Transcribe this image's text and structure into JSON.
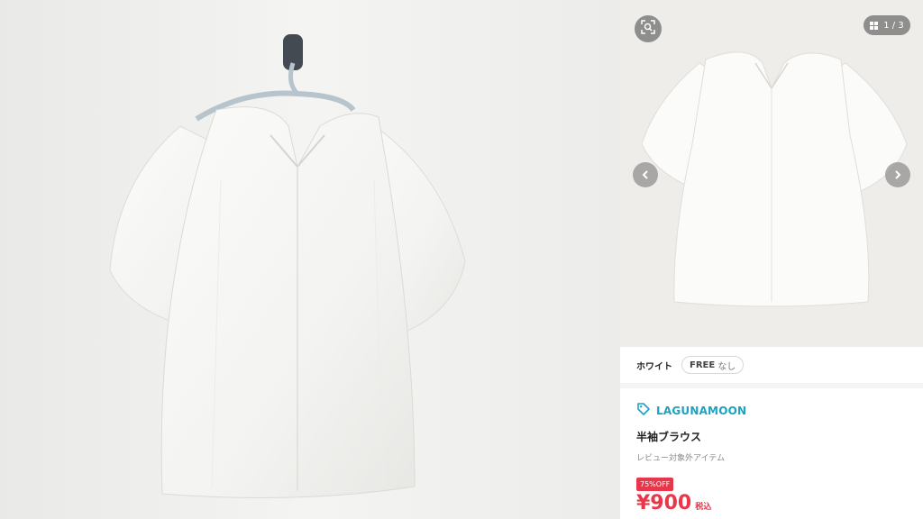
{
  "left_photo": {
    "description_icon": "hanging-blouse-photo"
  },
  "gallery": {
    "counter": "1 / 3",
    "icons": {
      "lens": "image-search-icon",
      "grid": "grid-icon",
      "prev": "chevron-left-icon",
      "next": "chevron-right-icon"
    }
  },
  "options": {
    "color": "ホワイト",
    "size": "FREE",
    "stock": "なし"
  },
  "product": {
    "brand": "LAGUNAMOON",
    "brand_icon": "tag-icon",
    "name": "半袖ブラウス",
    "review_note": "レビュー対象外アイテム",
    "discount": "75%OFF",
    "price": "¥900",
    "tax_label": "税込"
  },
  "colors": {
    "brand": "#1aa3c0",
    "sale": "#e8364a"
  }
}
